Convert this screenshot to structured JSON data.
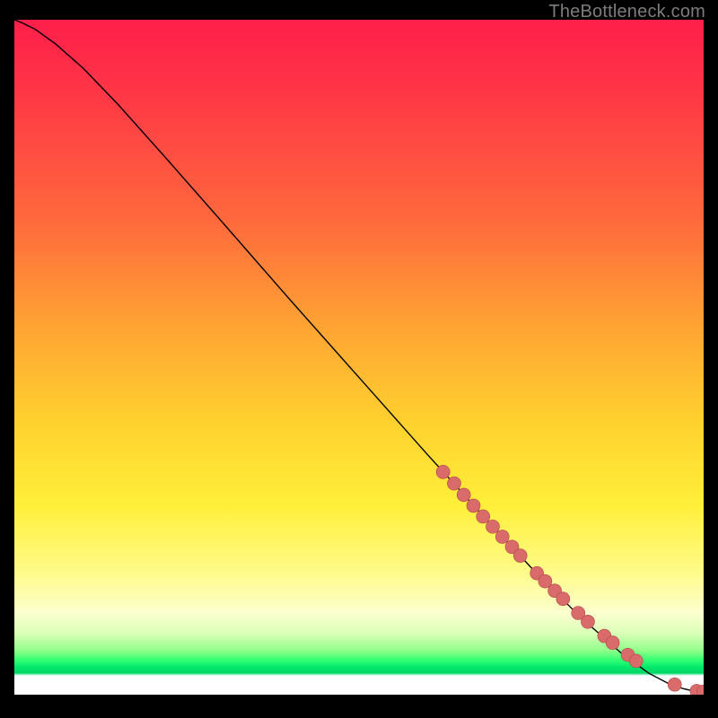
{
  "attribution": "TheBottleneck.com",
  "gradient_colors": {
    "top": "#ff1f4b",
    "mid_orange": "#ff8a36",
    "yellow": "#ffe234",
    "pale": "#fcffb8",
    "green": "#00e56b",
    "bottom": "#ffffff"
  },
  "curve_color": "#000000",
  "dot_fill": "#d96b6b",
  "dot_stroke": "#b34747",
  "chart_data": {
    "type": "line",
    "title": "",
    "xlabel": "",
    "ylabel": "",
    "xlim": [
      0,
      100
    ],
    "ylim": [
      0,
      100
    ],
    "note": "Axes unlabeled in source image; x/y are normalized 0–100 across the plot area. Curve descends from top-left to bottom-right. Dots are highlighted points along the lower-right portion of the curve.",
    "series": [
      {
        "name": "curve",
        "x": [
          0,
          1,
          3,
          6,
          10,
          15,
          22,
          30,
          40,
          50,
          60,
          68,
          75,
          82,
          88,
          92,
          95,
          97,
          98.5,
          100
        ],
        "y": [
          100,
          99.6,
          98.6,
          96.4,
          92.8,
          87.5,
          79.5,
          70.2,
          58.5,
          47,
          35.5,
          26.5,
          18.8,
          11.6,
          6.2,
          3.2,
          1.6,
          0.9,
          0.55,
          0.45
        ]
      },
      {
        "name": "dots",
        "x": [
          62.2,
          63.8,
          65.2,
          66.6,
          68.0,
          69.4,
          70.8,
          72.2,
          73.4,
          75.8,
          77.0,
          78.4,
          79.6,
          81.8,
          83.2,
          85.6,
          86.8,
          89.0,
          90.2,
          95.8,
          99.0,
          100.0
        ],
        "y": [
          33.0,
          31.3,
          29.6,
          28.0,
          26.4,
          24.9,
          23.4,
          21.9,
          20.6,
          18.0,
          16.8,
          15.4,
          14.2,
          12.1,
          10.8,
          8.7,
          7.7,
          5.9,
          5.0,
          1.5,
          0.55,
          0.45
        ]
      }
    ]
  }
}
